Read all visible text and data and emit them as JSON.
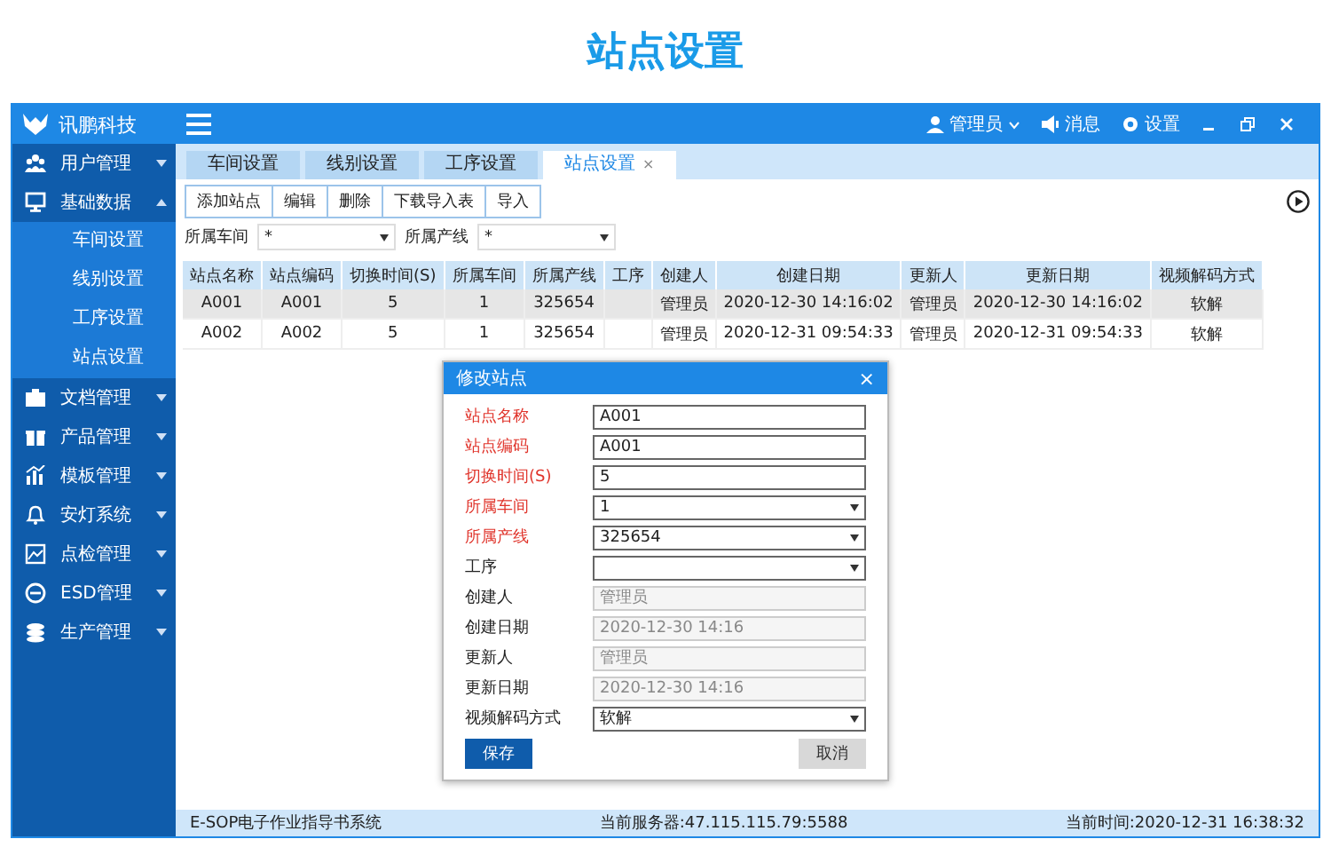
{
  "page_title": "站点设置",
  "app": {
    "name": "讯鹏科技"
  },
  "topbar": {
    "user": "管理员",
    "messages": "消息",
    "settings": "设置"
  },
  "sidebar": {
    "items": [
      {
        "label": "用户管理",
        "kind": "users",
        "expanded": false
      },
      {
        "label": "基础数据",
        "kind": "monitor",
        "expanded": true,
        "children": [
          {
            "label": "车间设置"
          },
          {
            "label": "线别设置"
          },
          {
            "label": "工序设置"
          },
          {
            "label": "站点设置"
          }
        ]
      },
      {
        "label": "文档管理",
        "kind": "briefcase",
        "expanded": false
      },
      {
        "label": "产品管理",
        "kind": "gift",
        "expanded": false
      },
      {
        "label": "模板管理",
        "kind": "chart",
        "expanded": false
      },
      {
        "label": "安灯系统",
        "kind": "bell",
        "expanded": false
      },
      {
        "label": "点检管理",
        "kind": "image",
        "expanded": false
      },
      {
        "label": "ESD管理",
        "kind": "disc",
        "expanded": false
      },
      {
        "label": "生产管理",
        "kind": "stack",
        "expanded": false
      }
    ]
  },
  "tabs": [
    {
      "label": "车间设置",
      "selected": false
    },
    {
      "label": "线别设置",
      "selected": false
    },
    {
      "label": "工序设置",
      "selected": false
    },
    {
      "label": "站点设置",
      "selected": true,
      "close": "×"
    }
  ],
  "toolbar": [
    "添加站点",
    "编辑",
    "删除",
    "下载导入表",
    "导入"
  ],
  "filters": [
    {
      "label": "所属车间",
      "value": "*"
    },
    {
      "label": "所属产线",
      "value": "*"
    }
  ],
  "table": {
    "columns": [
      "站点名称",
      "站点编码",
      "切换时间(S)",
      "所属车间",
      "所属产线",
      "工序",
      "创建人",
      "创建日期",
      "更新人",
      "更新日期",
      "视频解码方式"
    ],
    "rows": [
      {
        "selected": true,
        "cells": [
          "A001",
          "A001",
          "5",
          "1",
          "325654",
          "",
          "管理员",
          "2020-12-30 14:16:02",
          "管理员",
          "2020-12-30 14:16:02",
          "软解"
        ]
      },
      {
        "selected": false,
        "cells": [
          "A002",
          "A002",
          "5",
          "1",
          "325654",
          "",
          "管理员",
          "2020-12-31 09:54:33",
          "管理员",
          "2020-12-31 09:54:33",
          "软解"
        ]
      }
    ]
  },
  "dialog": {
    "title": "修改站点",
    "close": "×",
    "fields": [
      {
        "label": "站点名称",
        "value": "A001",
        "kind": "input",
        "required": true,
        "disabled": false
      },
      {
        "label": "站点编码",
        "value": "A001",
        "kind": "input",
        "required": true,
        "disabled": false
      },
      {
        "label": "切换时间(S)",
        "value": "5",
        "kind": "input",
        "required": true,
        "disabled": false
      },
      {
        "label": "所属车间",
        "value": "1",
        "kind": "select",
        "required": true,
        "disabled": false
      },
      {
        "label": "所属产线",
        "value": "325654",
        "kind": "select",
        "required": true,
        "disabled": false
      },
      {
        "label": "工序",
        "kind": "select",
        "required": false,
        "disabled": false
      },
      {
        "label": "创建人",
        "value": "管理员",
        "kind": "input",
        "required": false,
        "disabled": true
      },
      {
        "label": "创建日期",
        "value": "2020-12-30 14:16",
        "kind": "input",
        "required": false,
        "disabled": true
      },
      {
        "label": "更新人",
        "value": "管理员",
        "kind": "input",
        "required": false,
        "disabled": true
      },
      {
        "label": "更新日期",
        "value": "2020-12-30 14:16",
        "kind": "input",
        "required": false,
        "disabled": true
      },
      {
        "label": "视频解码方式",
        "value": "软解",
        "kind": "select",
        "required": false,
        "disabled": false
      }
    ],
    "save": "保存",
    "cancel": "取消"
  },
  "status_bar": {
    "system": "E-SOP电子作业指导书系统",
    "server": "当前服务器:47.115.115.79:5588",
    "time": "当前时间:2020-12-31 16:38:32"
  }
}
